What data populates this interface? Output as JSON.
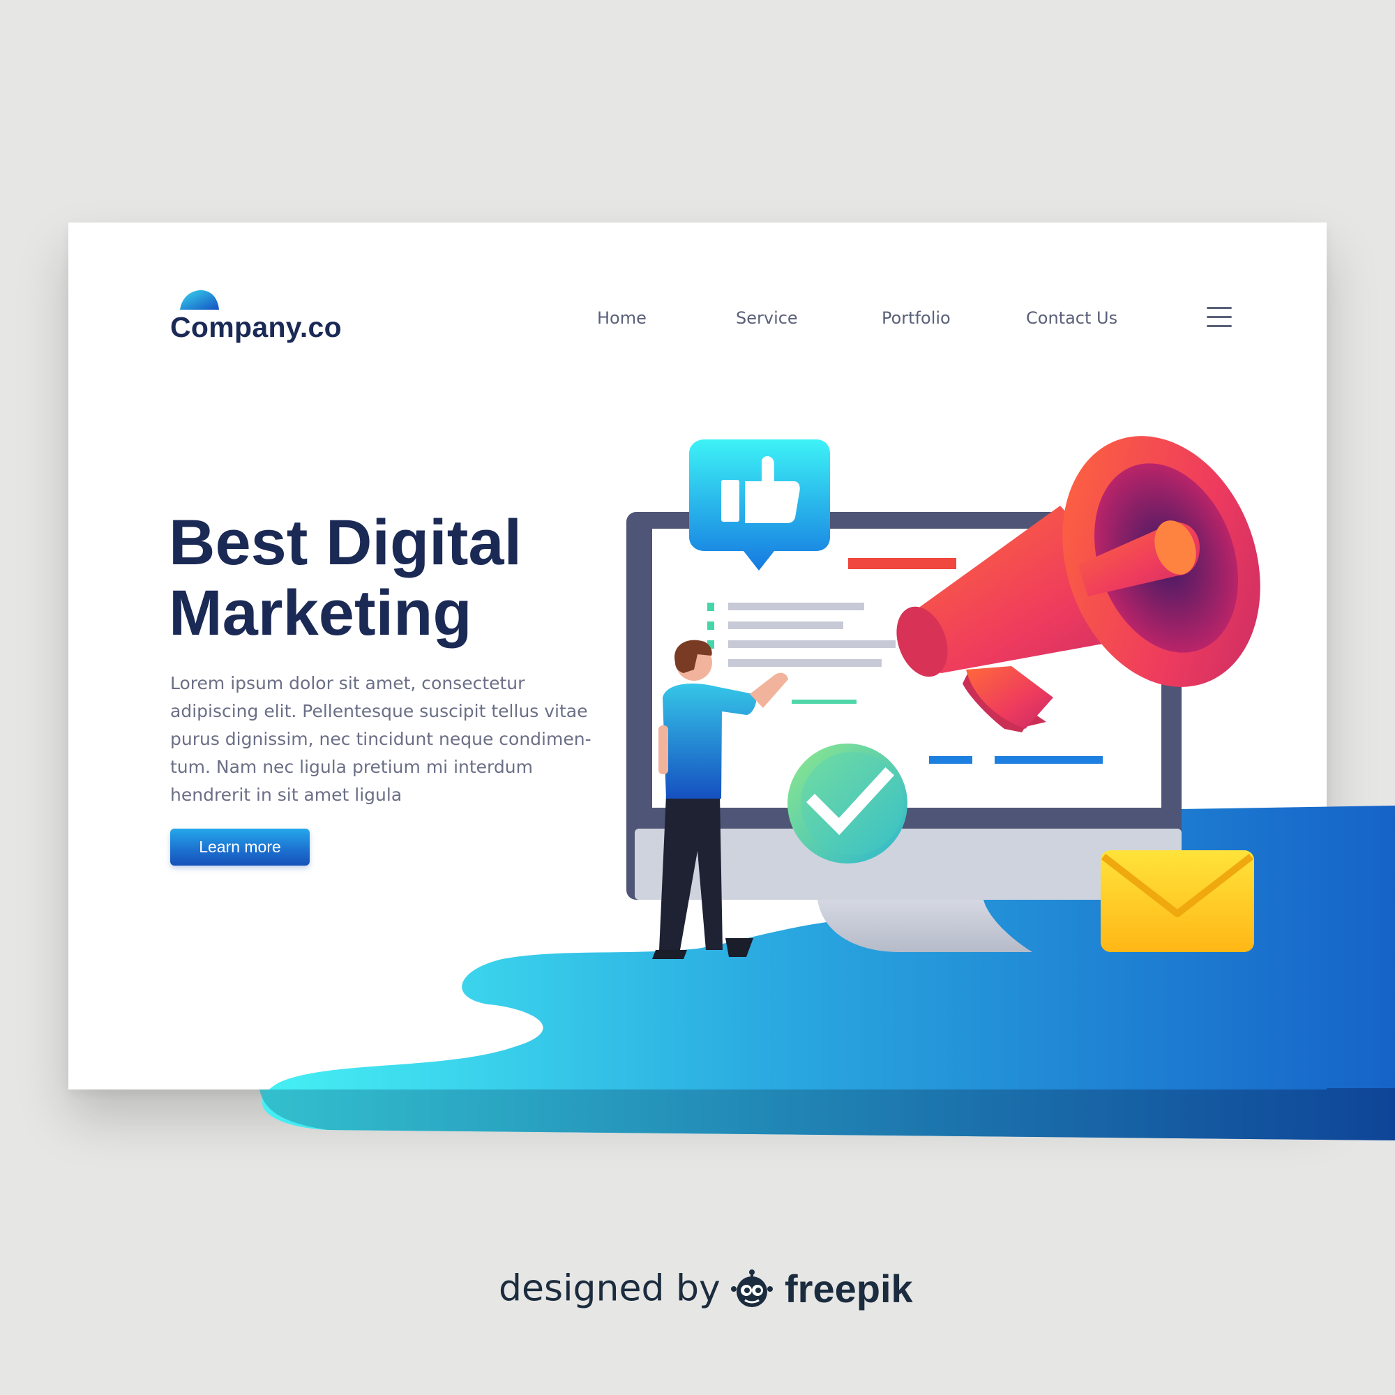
{
  "brand": {
    "name": "Company.co"
  },
  "nav": {
    "items": [
      {
        "label": "Home"
      },
      {
        "label": "Service"
      },
      {
        "label": "Portfolio"
      },
      {
        "label": "Contact Us"
      }
    ],
    "menu_icon": "hamburger-menu-icon"
  },
  "hero": {
    "title_line1": "Best Digital",
    "title_line2": "Marketing",
    "body_lines": [
      "Lorem ipsum dolor sit amet, consectetur",
      "adipiscing elit. Pellentesque suscipit tellus vitae",
      "purus dignissim, nec tincidunt neque condimen-",
      "tum. Nam nec ligula pretium mi interdum",
      "hendrerit in sit amet ligula"
    ],
    "cta_label": "Learn more"
  },
  "illustration": {
    "icons": [
      "monitor-icon",
      "thumbs-up-icon",
      "megaphone-icon",
      "checkmark-icon",
      "envelope-icon",
      "person-figure"
    ]
  },
  "credit": {
    "prefix": "designed by",
    "brand": "freepik",
    "icon": "freepik-logo-icon"
  },
  "colors": {
    "background": "#e6e6e4",
    "card": "#ffffff",
    "navy": "#1b2a55",
    "accent_blue": "#1c6fcf",
    "cyan": "#3ee8f2",
    "megaphone_red": "#ee4055",
    "envelope_yellow": "#ffc81e",
    "check_green": "#5fd89a"
  }
}
